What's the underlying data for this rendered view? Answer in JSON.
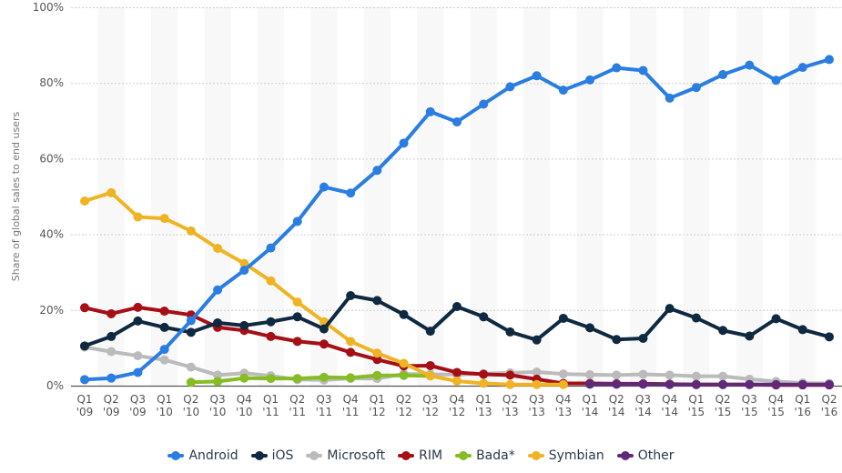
{
  "chart_data": {
    "type": "line",
    "title": "",
    "xlabel": "",
    "ylabel": "Share of global sales to end users",
    "ylim": [
      0,
      100
    ],
    "yticks": [
      "0%",
      "20%",
      "40%",
      "60%",
      "80%",
      "100%"
    ],
    "ytick_values": [
      0,
      20,
      40,
      60,
      80,
      100
    ],
    "grid": true,
    "legend_position": "bottom",
    "categories": [
      [
        "Q1",
        "'09"
      ],
      [
        "Q2",
        "'09"
      ],
      [
        "Q3",
        "'09"
      ],
      [
        "Q1",
        "'10"
      ],
      [
        "Q2",
        "'10"
      ],
      [
        "Q3",
        "'10"
      ],
      [
        "Q4",
        "'10"
      ],
      [
        "Q1",
        "'11"
      ],
      [
        "Q2",
        "'11"
      ],
      [
        "Q3",
        "'11"
      ],
      [
        "Q4",
        "'11"
      ],
      [
        "Q1",
        "'12"
      ],
      [
        "Q2",
        "'12"
      ],
      [
        "Q3",
        "'12"
      ],
      [
        "Q4",
        "'12"
      ],
      [
        "Q1",
        "'13"
      ],
      [
        "Q2",
        "'13"
      ],
      [
        "Q3",
        "'13"
      ],
      [
        "Q4",
        "'13"
      ],
      [
        "Q1",
        "'14"
      ],
      [
        "Q2",
        "'14"
      ],
      [
        "Q3",
        "'14"
      ],
      [
        "Q4",
        "'14"
      ],
      [
        "Q1",
        "'15"
      ],
      [
        "Q2",
        "'15"
      ],
      [
        "Q3",
        "'15"
      ],
      [
        "Q4",
        "'15"
      ],
      [
        "Q1",
        "'16"
      ],
      [
        "Q2",
        "'16"
      ]
    ],
    "series": [
      {
        "name": "Android",
        "color": "#2a7de1",
        "values": [
          1.6,
          2.0,
          3.5,
          9.6,
          17.2,
          25.3,
          30.5,
          36.4,
          43.4,
          52.5,
          50.9,
          56.9,
          64.1,
          72.4,
          69.7,
          74.4,
          79.0,
          81.9,
          78.1,
          80.8,
          84.0,
          83.3,
          76.0,
          78.8,
          82.2,
          84.7,
          80.7,
          84.1,
          86.2
        ]
      },
      {
        "name": "iOS",
        "color": "#0f2940",
        "values": [
          10.5,
          13.0,
          17.1,
          15.4,
          14.1,
          16.6,
          15.9,
          16.9,
          18.2,
          15.0,
          23.8,
          22.5,
          18.8,
          14.4,
          20.9,
          18.2,
          14.2,
          12.1,
          17.8,
          15.3,
          12.2,
          12.5,
          20.4,
          17.9,
          14.6,
          13.1,
          17.7,
          14.8,
          12.9
        ]
      },
      {
        "name": "Microsoft",
        "color": "#bbbbbb",
        "values": [
          10.2,
          9.0,
          7.9,
          6.8,
          4.9,
          2.8,
          3.3,
          2.6,
          1.6,
          1.5,
          1.9,
          1.9,
          3.1,
          3.0,
          2.9,
          3.2,
          3.4,
          3.6,
          3.1,
          2.9,
          2.8,
          3.0,
          2.8,
          2.5,
          2.5,
          1.7,
          1.1,
          0.7,
          0.6
        ]
      },
      {
        "name": "RIM",
        "color": "#a50f15",
        "values": [
          20.6,
          19.0,
          20.7,
          19.7,
          18.7,
          15.4,
          14.6,
          13.0,
          11.7,
          11.0,
          8.8,
          6.9,
          5.2,
          5.3,
          3.5,
          3.0,
          2.8,
          1.7,
          0.6,
          0.6,
          0.5,
          0.5,
          0.4,
          0.3,
          0.3,
          0.3,
          0.2,
          0.2,
          0.2
        ]
      },
      {
        "name": "Bada*",
        "color": "#86bc24",
        "values": [
          null,
          null,
          null,
          null,
          0.9,
          1.1,
          2.0,
          1.9,
          1.9,
          2.2,
          2.1,
          2.7,
          2.7,
          2.6,
          null,
          null,
          null,
          null,
          null,
          null,
          null,
          null,
          null,
          null,
          null,
          null,
          null,
          null,
          null
        ]
      },
      {
        "name": "Symbian",
        "color": "#f0b323",
        "values": [
          48.8,
          51.0,
          44.6,
          44.2,
          40.9,
          36.3,
          32.3,
          27.7,
          22.1,
          16.9,
          11.7,
          8.6,
          5.9,
          2.6,
          1.2,
          0.6,
          0.3,
          0.3,
          0.3,
          null,
          null,
          null,
          null,
          null,
          null,
          null,
          null,
          null,
          null
        ]
      },
      {
        "name": "Other",
        "color": "#5f2a7a",
        "values": [
          null,
          null,
          null,
          null,
          null,
          null,
          null,
          null,
          null,
          null,
          null,
          null,
          null,
          null,
          null,
          null,
          null,
          null,
          null,
          0.4,
          0.4,
          0.4,
          0.3,
          0.3,
          0.3,
          0.3,
          0.3,
          0.3,
          0.3
        ]
      }
    ]
  }
}
